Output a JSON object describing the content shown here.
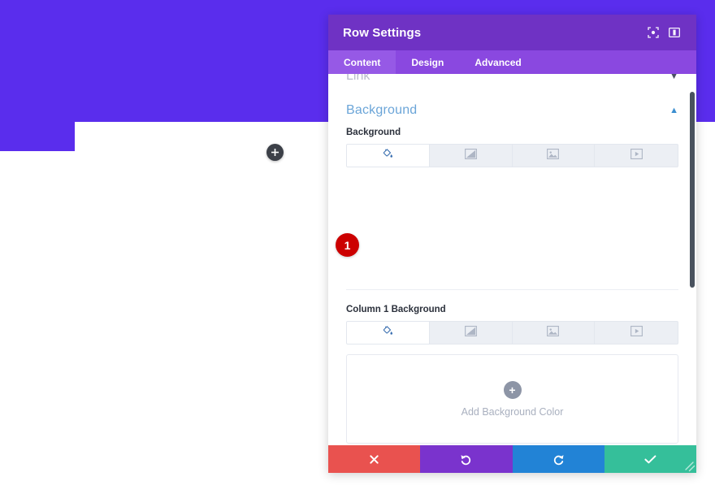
{
  "canvas": {
    "hero_color": "#5a2ded",
    "add_row_icon": "plus-icon"
  },
  "modal": {
    "title": "Row Settings",
    "header_color": "#6f32c4",
    "tabs_color": "#8a48e0",
    "header_icons": [
      {
        "name": "expand-icon",
        "label": "Expand"
      },
      {
        "name": "layout-toggle-icon",
        "label": "Layout"
      }
    ],
    "tabs": [
      {
        "label": "Content",
        "active": true
      },
      {
        "label": "Design",
        "active": false
      },
      {
        "label": "Advanced",
        "active": false
      }
    ],
    "sections": [
      {
        "title": "Link",
        "state": "collapsed"
      },
      {
        "title": "Background",
        "state": "expanded"
      }
    ],
    "background": {
      "field_label": "Background",
      "types": [
        {
          "name": "background-color-tab",
          "icon": "paint-bucket-icon",
          "active": true
        },
        {
          "name": "background-gradient-tab",
          "icon": "gradient-icon",
          "active": false
        },
        {
          "name": "background-image-tab",
          "icon": "image-icon",
          "active": false
        },
        {
          "name": "background-video-tab",
          "icon": "video-icon",
          "active": false
        }
      ]
    },
    "column_background": {
      "field_label": "Column 1 Background",
      "types": [
        {
          "name": "column-background-color-tab",
          "icon": "paint-bucket-icon",
          "active": true
        },
        {
          "name": "column-background-gradient-tab",
          "icon": "gradient-icon",
          "active": false
        },
        {
          "name": "column-background-image-tab",
          "icon": "image-icon",
          "active": false
        },
        {
          "name": "column-background-video-tab",
          "icon": "video-icon",
          "active": false
        }
      ],
      "dropzone_label": "Add Background Color",
      "dropzone_icon": "plus-icon"
    },
    "footer": [
      {
        "name": "cancel-button",
        "icon": "close-icon",
        "color": "#e9524f"
      },
      {
        "name": "undo-button",
        "icon": "undo-icon",
        "color": "#7a33cd"
      },
      {
        "name": "redo-button",
        "icon": "redo-icon",
        "color": "#2283d6"
      },
      {
        "name": "save-button",
        "icon": "check-icon",
        "color": "#35bf9a"
      }
    ]
  },
  "annotation": {
    "badge_number": "1",
    "badge_color": "#cc0000"
  }
}
